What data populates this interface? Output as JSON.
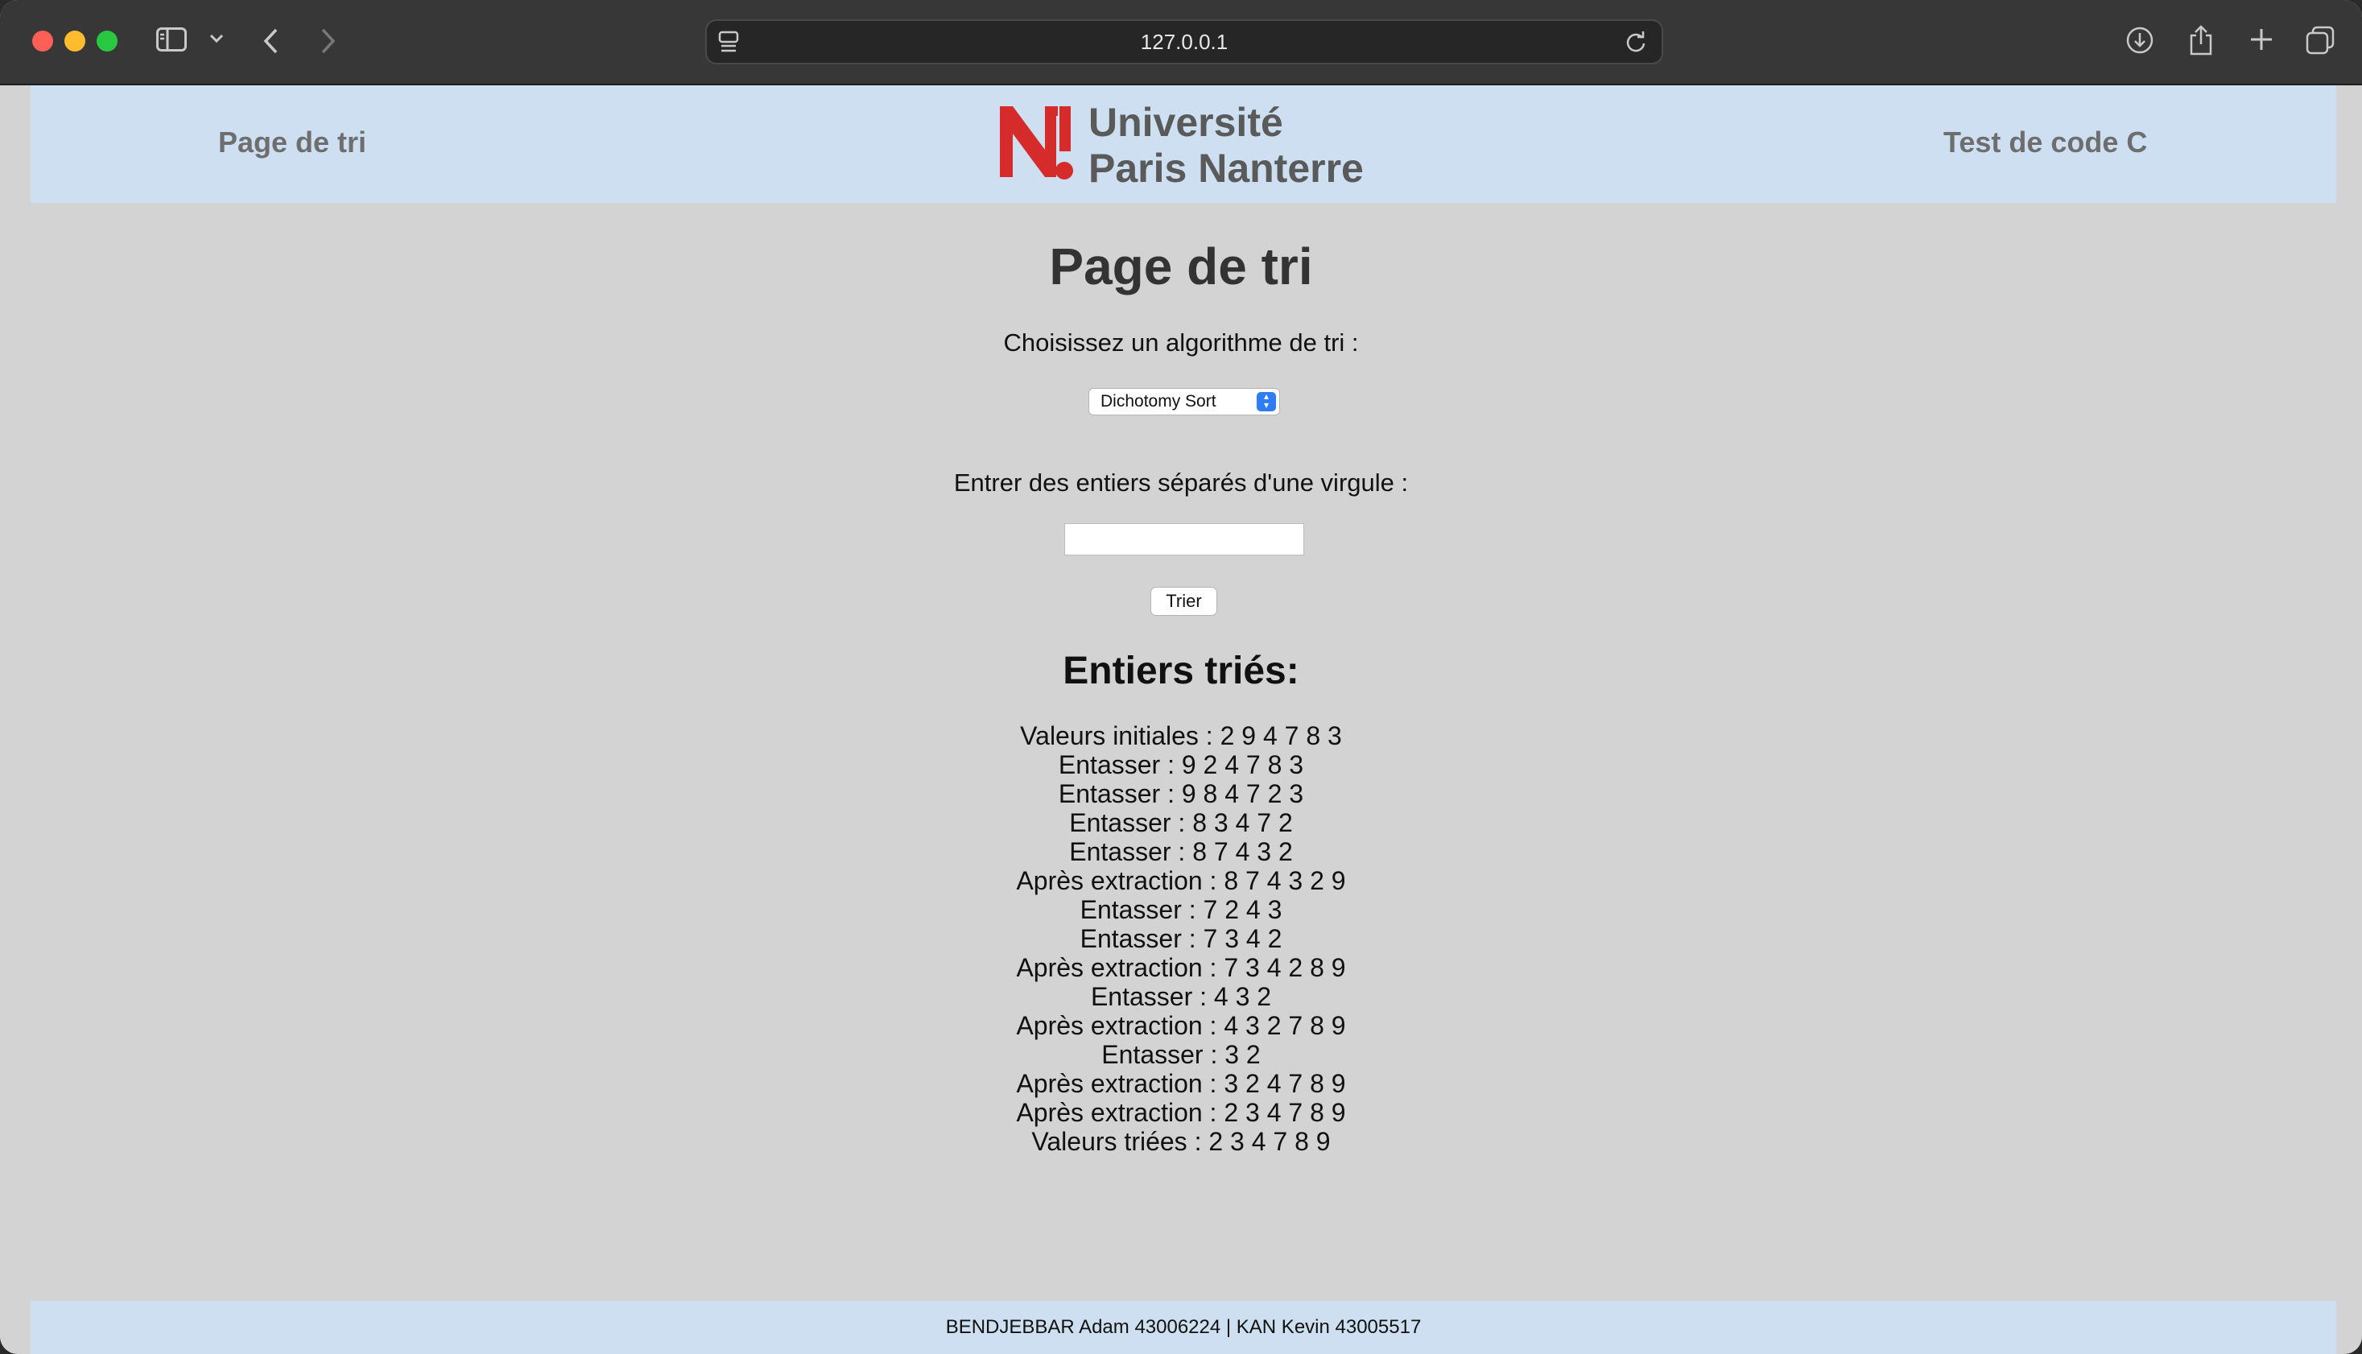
{
  "browser": {
    "url": "127.0.0.1"
  },
  "header": {
    "nav_left": "Page de tri",
    "logo_line1": "Université",
    "logo_line2": "Paris Nanterre",
    "nav_right": "Test de code C"
  },
  "main": {
    "title": "Page de tri",
    "algo_label": "Choisissez un algorithme de tri :",
    "algo_selected": "Dichotomy Sort",
    "input_label": "Entrer des entiers séparés d'une virgule :",
    "input_value": "",
    "submit_label": "Trier",
    "results_title": "Entiers triés:",
    "results": [
      "Valeurs initiales : 2 9 4 7 8 3",
      "Entasser : 9 2 4 7 8 3",
      "Entasser : 9 8 4 7 2 3",
      "Entasser : 8 3 4 7 2",
      "Entasser : 8 7 4 3 2",
      "Après extraction : 8 7 4 3 2 9",
      "Entasser : 7 2 4 3",
      "Entasser : 7 3 4 2",
      "Après extraction : 7 3 4 2 8 9",
      "Entasser : 4 3 2",
      "Après extraction : 4 3 2 7 8 9",
      "Entasser : 3 2",
      "Après extraction : 3 2 4 7 8 9",
      "Après extraction : 2 3 4 7 8 9",
      "Valeurs triées : 2 3 4 7 8 9"
    ]
  },
  "footer": {
    "text": "BENDJEBBAR Adam 43006224 | KAN Kevin 43005517"
  },
  "colors": {
    "header_bg": "#cddff0",
    "page_bg": "#d3d3d3",
    "logo_red": "#d52b2b"
  }
}
